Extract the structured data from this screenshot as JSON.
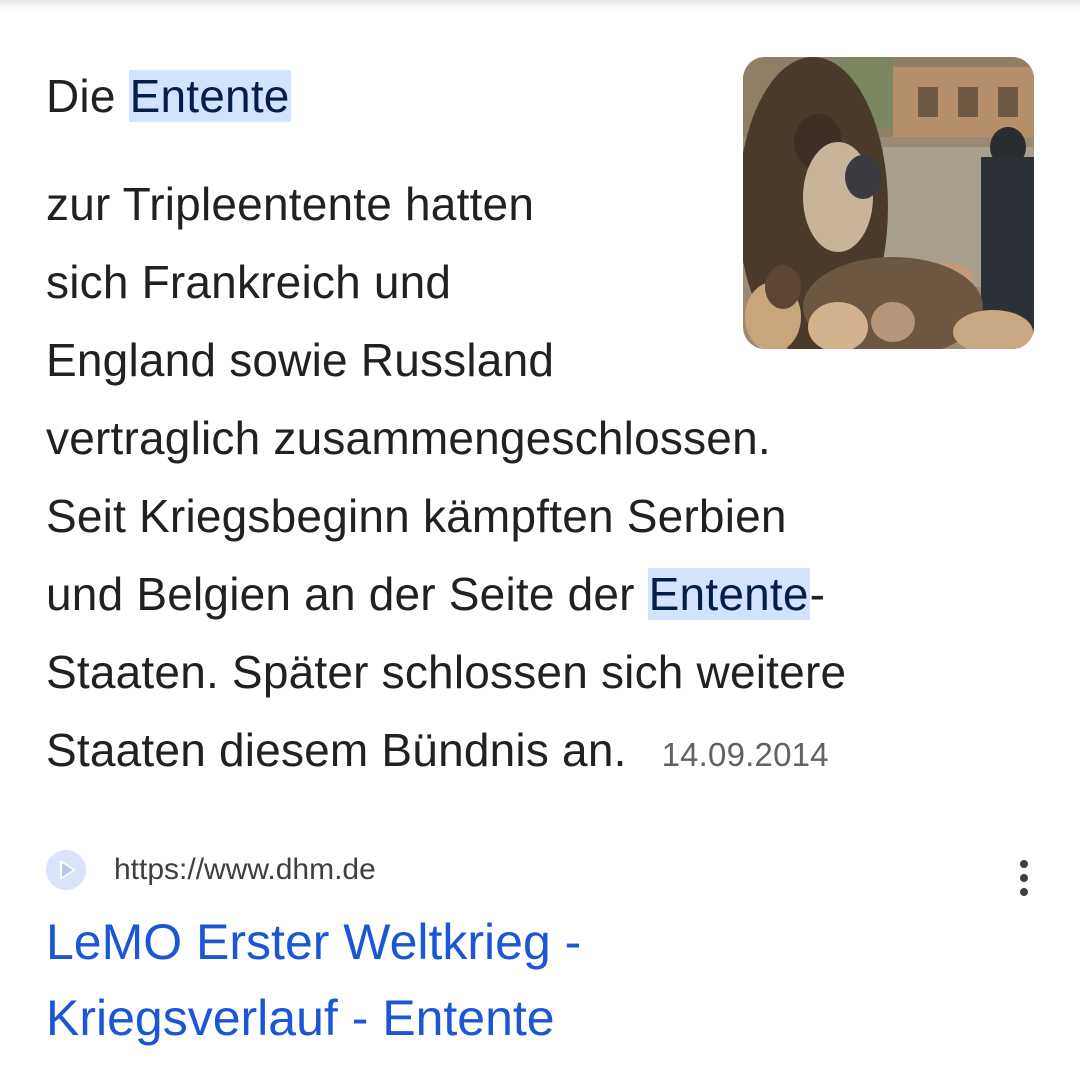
{
  "snippet": {
    "heading_prefix": "Die",
    "heading_highlight": "Entente",
    "lines": [
      "zur Tripleentente hatten",
      "sich Frankreich und",
      "England sowie Russland",
      "vertraglich zusammengeschlossen.",
      "Seit Kriegsbeginn kämpften Serbien"
    ],
    "line6_prefix": "und Belgien an der Seite der",
    "line6_highlight": "Entente",
    "line6_suffix": "-",
    "line7": "Staaten. Später schlossen sich weitere",
    "line8": "Staaten diesem Bündnis an.",
    "date": "14.09.2014"
  },
  "thumbnail": {
    "icon": "historical-painting-thumbnail"
  },
  "result": {
    "url": "https://www.dhm.de",
    "favicon": "dhm-play-icon",
    "title_line1": "LeMO Erster Weltkrieg -",
    "title_line2": "Kriegsverlauf - Entente",
    "menu_icon": "more-vert-icon"
  },
  "colors": {
    "highlight_bg": "#d3e3fd",
    "link": "#1a56d6",
    "text": "#202124",
    "meta": "#5f6368"
  }
}
